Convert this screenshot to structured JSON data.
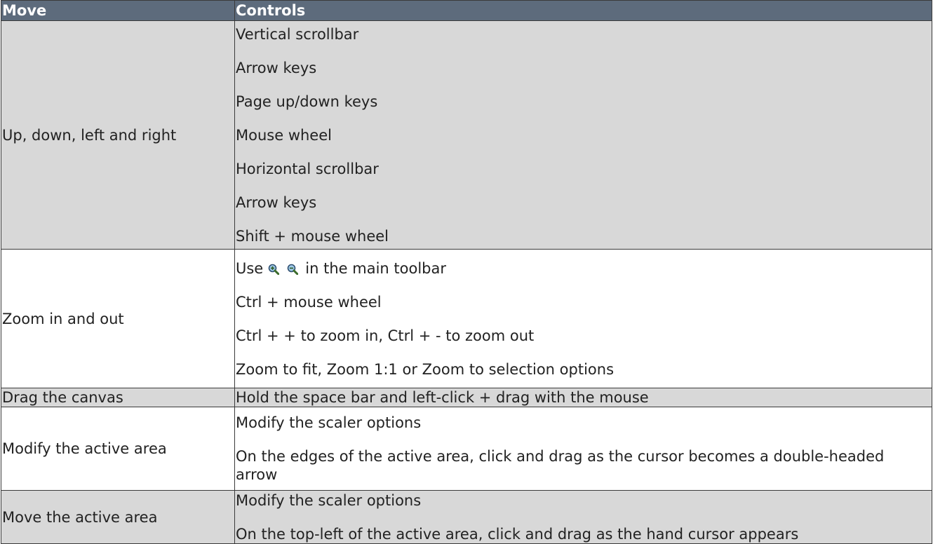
{
  "header": {
    "move": "Move",
    "controls": "Controls"
  },
  "rows": [
    {
      "move": "Up, down, left and right",
      "controls": [
        "Vertical scrollbar",
        "Arrow keys",
        "Page up/down keys",
        "Mouse wheel",
        "Horizontal scrollbar",
        "Arrow keys",
        "Shift + mouse wheel"
      ]
    },
    {
      "move": "Zoom in and out",
      "controls_prefix": "Use",
      "controls_suffix": "in the main toolbar",
      "icons": [
        "zoom-in-icon",
        "zoom-out-icon"
      ],
      "controls": [
        "Ctrl + mouse wheel",
        "Ctrl + + to zoom in, Ctrl + - to zoom out",
        "Zoom to fit, Zoom 1:1 or Zoom to selection options"
      ]
    },
    {
      "move": "Drag the canvas",
      "controls": [
        "Hold the space bar and left-click + drag with the mouse"
      ]
    },
    {
      "move": "Modify the active area",
      "controls": [
        "Modify the scaler options",
        "On the edges of the active area, click and drag as the cursor becomes a double-headed arrow"
      ]
    },
    {
      "move": "Move the active area",
      "controls": [
        "Modify the scaler options",
        "On the top-left of the active area, click and drag as the hand cursor appears"
      ]
    }
  ],
  "colors": {
    "header_bg": "#5d6b7c",
    "row_grey": "#d8d8d8",
    "row_white": "#ffffff"
  }
}
